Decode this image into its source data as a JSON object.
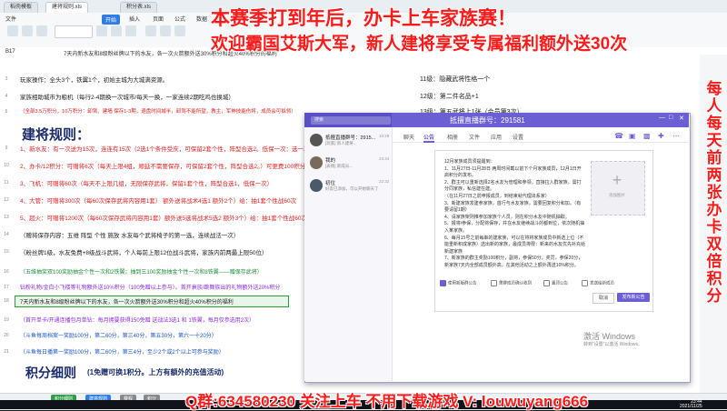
{
  "app": {
    "tabs": [
      "稻壳模板",
      "建将规则.xls",
      "积分表.xls"
    ],
    "menu": [
      "文件",
      "开始",
      "插入",
      "页面",
      "公式",
      "数据",
      "审阅",
      "视图",
      "工具"
    ],
    "cell_ref": "B17",
    "formula": "7天内新水友和8级粉丝牌以下的水友，各一次火箭额外送30%积分和超火40%积分的福利"
  },
  "overlays": {
    "headline_1": "本赛季打到年后，办卡上车家族赛！",
    "headline_2": "欢迎霸国艾斯大军，新人建将享受专属福利额外送30次",
    "side_text": "每人每天前两张办卡双倍积分",
    "bottom_text": "Q群:634580230 关注上车 不用下载游戏 V: louwuyang666"
  },
  "sheet": {
    "rows": [
      {
        "n": "3",
        "text": "玩家操作：全头3个，铁翼1个，初始主城为大城满资源。",
        "cls": ""
      },
      {
        "n": "4",
        "text": "家族相助城市为粮机（每行2-4期换一次城市/每天一换，一家连续2期吃鸡也换城）",
        "cls": ""
      },
      {
        "n": "5",
        "text": "（全部3.5万积分，10万积分：卸驾、建墙 保存1-3期，退盘时间城半，卸驾不能所望，教主，军神技能伤将，成员会可拟领）",
        "cls": "red"
      },
      {
        "n": "9",
        "text": "1、新水友：有一次送为15次，连连有15次（2选1个条件受庆，可保留2套个性，阵型合选2。低保一次：选一次）",
        "cls": "red"
      },
      {
        "n": "10",
        "text": "2、办卡/12积分：可赠将6次（每天上限4组，顺延不需要保存，可保留2套个性，阵型合选2。）可更费100积分",
        "cls": "red"
      },
      {
        "n": "11",
        "text": "3、飞机：可赠将60次（每天不上限几组，无限保存武将，保留1套个性，阵型合选1，低保一次）",
        "cls": "red"
      },
      {
        "n": "12",
        "text": "4、大管：可赠将300次（每60次保存武将内容用1套） 额外送将战术4选1 额外2个）给：抽1套个性战60次",
        "cls": "red"
      },
      {
        "n": "13",
        "text": "5、超火：可赠将1200次（每60次保存武将内容用1套）额外送5选将战术5选2 额外3个）给：抽1套个性战60次",
        "cls": "red"
      },
      {
        "n": "14",
        "text": "（赠将保存内容：五维 阵型 个性 施放 水友每个武将椅子的第一选，连续战法一次）",
        "cls": ""
      },
      {
        "n": "15",
        "text": "（粉丝牌1级，水友免费+8级战斗武将，个人每前上限12位战斗武将，家族内前两最上限50位）",
        "cls": ""
      },
      {
        "n": "16",
        "text": "（五维抽奖双100奖励抽金个性一次和2铁翼；抽到三100奖励抽金个性一次和8铁翼——赠保存武将）",
        "cls": "green"
      },
      {
        "n": "17",
        "text": "钻粉礼物/金白小飞楼等礼物额外送10%积分（100免赠以上参与）。首开衰族/跳舞族出的礼物额外送20%积分",
        "cls": "purple"
      },
      {
        "n": "18",
        "text": "7天内新水友和8级粉丝牌以下的水友，各一次火箭额外送30%积分和超火40%积分的福利",
        "cls": ""
      },
      {
        "n": "19",
        "text": "（首开单卡/开通连播包月单钻：每月拥要获得150免赠 送战法3选1 和 1铁翼，每月仅参选用2次）",
        "cls": "purple"
      },
      {
        "n": "20",
        "text": "（斗鱼每周档案一奖励100分，第二60分，第三40分，第五30分，第六一十20分）",
        "cls": "blue"
      },
      {
        "n": "21",
        "text": "（斗鱼每日播第一奖励100分，第二60分，第三4分，至少2个或2个以上可参与奖励）",
        "cls": "blue"
      }
    ],
    "title": "建将规则：",
    "score_title": "积分细则",
    "score_sub": "(1免赠可换1积分。上方有额外的充值活动)",
    "right_rows": [
      {
        "n": "11",
        "text": "11级：隐藏武将性格一个"
      },
      {
        "n": "12",
        "text": "12级：第二件名品+1"
      },
      {
        "n": "13",
        "text": "13级：第五武将上1张（会员第3次）"
      }
    ],
    "sheet_tabs": [
      "积分细则",
      "建将规则",
      "赛程",
      "积分"
    ]
  },
  "chat": {
    "search_placeholder": "搜索",
    "window_title": "抵擅直播群号：291581",
    "contacts": [
      {
        "name": "抵擅直播群号：2915...",
        "msg": "[玩家] 新人建将...",
        "time": "10:29"
      },
      {
        "name": "我的",
        "msg": "[表情] 新成员...",
        "time": "23:44"
      },
      {
        "name": "初位",
        "msg": "好友已添加，可以开始聊天了",
        "time": "22:32"
      }
    ],
    "tabs": [
      "聊天",
      "公告",
      "相册",
      "文件",
      "应用",
      "设置"
    ],
    "active_tab": "公告",
    "announcement": [
      "12月家族成员须提醒到：",
      "1、11月27日-11月28日 两周时间截以前下个月家族成员，12月1日开启积分的发布。",
      "2、群主可以重新选择2名水友为管理和参领，直接拉入群家族，需打分同家族，私信建在建。",
      "（在11月27日之前申报成员，到结束就代理出系家）",
      "3、新建家族发建参家族，首行与水友家族，需要回复积分和加。（有要请留1期）",
      "4、请家族架则推参加家族个人员，则在积分水友中随机抽取。",
      "5、报将/参保，分配将保存，并在水友继续战斗的都到位，依次随机抽入某家族。",
      "6、每月15号之前每串的建家族，可以在将将家族成员中新选上位（不能重新积成家族）选出新的家族，最成员排限：新来的水友优先补充给新建家族",
      "7、新家族的群主奖励100积分，副将，参保50分，奖罚，参保20分，新家族7天内全部成员额外高，在其他活动之上额外再送10%积分。"
    ],
    "image_label": "添加图片",
    "options": [
      "使用新版群公告",
      "需群成员确认收到",
      "置顶公告",
      "发送给新成员"
    ],
    "cancel": "取消",
    "publish": "发布新公告"
  },
  "system": {
    "activate_title": "激活 Windows",
    "activate_sub": "转到“设置”以激活 Windows。",
    "time": "23:44",
    "date": "2021/11/25"
  }
}
